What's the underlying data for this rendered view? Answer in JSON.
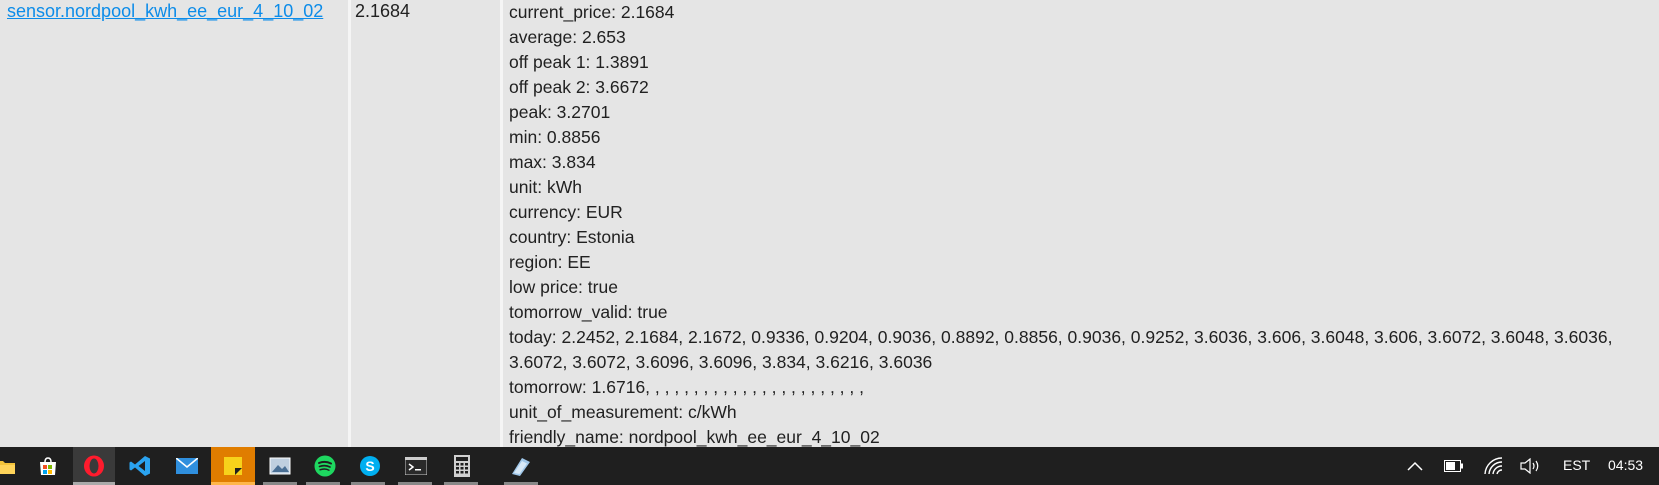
{
  "entity": {
    "id": "sensor.nordpool_kwh_ee_eur_4_10_02",
    "state": "2.1684"
  },
  "attributes": [
    "current_price: 2.1684",
    "average: 2.653",
    "off peak 1: 1.3891",
    "off peak 2: 3.6672",
    "peak: 3.2701",
    "min: 0.8856",
    "max: 3.834",
    "unit: kWh",
    "currency: EUR",
    "country: Estonia",
    "region: EE",
    "low price: true",
    "tomorrow_valid: true",
    "today: 2.2452, 2.1684, 2.1672, 0.9336, 0.9204, 0.9036, 0.8892, 0.8856, 0.9036, 0.9252, 3.6036, 3.606, 3.6048, 3.606, 3.6072, 3.6048, 3.6036, 3.6072, 3.6072, 3.6096, 3.6096, 3.834, 3.6216, 3.6036",
    "tomorrow: 1.6716, , , , , , , , , , , , , , , , , , , , , , ,",
    "unit_of_measurement: c/kWh",
    "friendly_name: nordpool_kwh_ee_eur_4_10_02"
  ],
  "taskbar": {
    "apps": [
      {
        "name": "file-explorer-icon",
        "color": "#f3c33b"
      },
      {
        "name": "store-icon",
        "color": "#f5b400"
      },
      {
        "name": "opera-icon",
        "color": "#ff1b2d"
      },
      {
        "name": "vscode-icon",
        "color": "#2aa3f0"
      },
      {
        "name": "mail-icon",
        "color": "#2f8fde"
      },
      {
        "name": "sticky-notes-icon",
        "color": "#f7d21b"
      },
      {
        "name": "photos-icon",
        "color": "#bfcfdf"
      },
      {
        "name": "spotify-icon",
        "color": "#1ed760"
      },
      {
        "name": "skype-icon",
        "color": "#00aff0"
      },
      {
        "name": "terminal-icon",
        "color": "#cccccc"
      },
      {
        "name": "calculator-icon",
        "color": "#d0d0d0"
      },
      {
        "name": "snipping-icon",
        "color": "#9fc6e8"
      }
    ],
    "tray": {
      "language": "EST",
      "time": "04:53"
    }
  }
}
